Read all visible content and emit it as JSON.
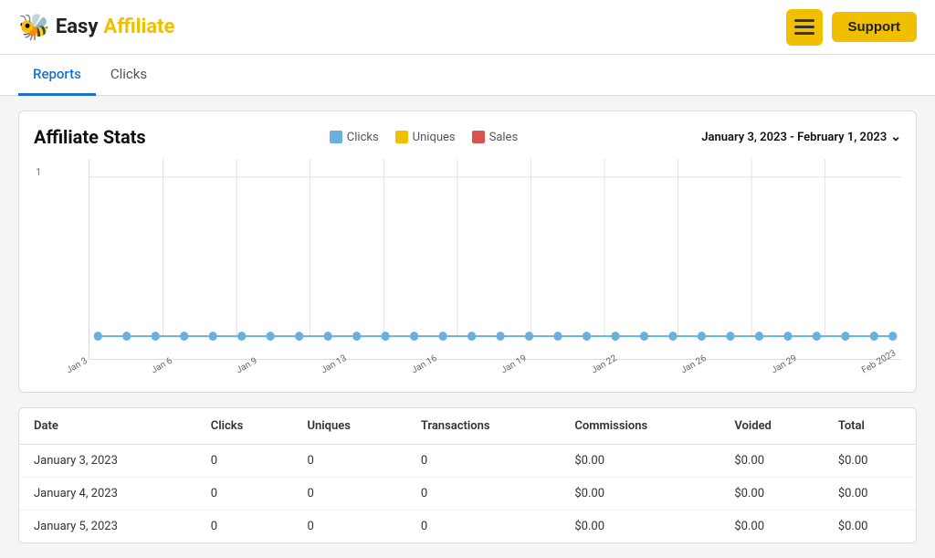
{
  "header": {
    "logo_easy": "Easy",
    "logo_affiliate": "Affiliate",
    "support_label": "Support",
    "bee_icon": "🐝"
  },
  "tabs": [
    {
      "id": "reports",
      "label": "Reports",
      "active": true
    },
    {
      "id": "clicks",
      "label": "Clicks",
      "active": false
    }
  ],
  "stats": {
    "title": "Affiliate Stats",
    "legend": [
      {
        "id": "clicks",
        "label": "Clicks",
        "color": "#6ab0de"
      },
      {
        "id": "uniques",
        "label": "Uniques",
        "color": "#f0c000"
      },
      {
        "id": "sales",
        "label": "Sales",
        "color": "#d9534f"
      }
    ],
    "date_range": "January 3, 2023 - February 1, 2023",
    "chart_y_label": "1",
    "x_labels": [
      "Jan 3",
      "Jan 6",
      "Jan 9",
      "Jan 13",
      "Jan 16",
      "Jan 19",
      "Jan 22",
      "Jan 26",
      "Jan 29",
      "Feb 2023"
    ]
  },
  "table": {
    "columns": [
      "Date",
      "Clicks",
      "Uniques",
      "Transactions",
      "Commissions",
      "Voided",
      "Total"
    ],
    "rows": [
      {
        "date": "January 3, 2023",
        "clicks": "0",
        "uniques": "0",
        "transactions": "0",
        "commissions": "$0.00",
        "voided": "$0.00",
        "total": "$0.00"
      },
      {
        "date": "January 4, 2023",
        "clicks": "0",
        "uniques": "0",
        "transactions": "0",
        "commissions": "$0.00",
        "voided": "$0.00",
        "total": "$0.00"
      },
      {
        "date": "January 5, 2023",
        "clicks": "0",
        "uniques": "0",
        "transactions": "0",
        "commissions": "$0.00",
        "voided": "$0.00",
        "total": "$0.00"
      }
    ]
  }
}
